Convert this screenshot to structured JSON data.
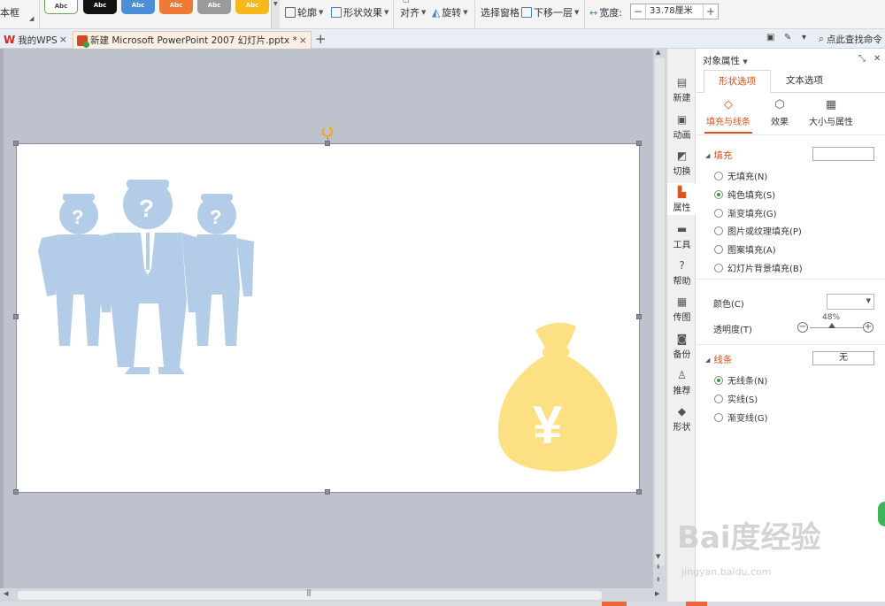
{
  "ribbon": {
    "frame_label": "本框",
    "swatches": [
      "Abc",
      "Abc",
      "Abc",
      "Abc",
      "Abc",
      "Abc"
    ],
    "outline": "轮廓",
    "shape_effects": "形状效果",
    "align": "对齐",
    "rotate": "旋转",
    "selection_pane": "选择窗格",
    "send_backward": "下移一层",
    "width_label": "宽度:",
    "width_value": "33.78厘米",
    "minus": "−",
    "plus": "+"
  },
  "tabs": {
    "home": "我的WPS",
    "doc": "新建 Microsoft PowerPoint 2007 幻灯片.pptx *",
    "search_cmd": "点此查找命令"
  },
  "rail": {
    "items": [
      "新建",
      "动画",
      "切换",
      "属性",
      "工具",
      "帮助",
      "传图",
      "备份",
      "推荐",
      "形状"
    ]
  },
  "panel": {
    "title": "对象属性",
    "tabs": [
      "形状选项",
      "文本选项"
    ],
    "subtabs": [
      "填充与线条",
      "效果",
      "大小与属性"
    ],
    "fill": {
      "heading": "填充",
      "options": [
        "无填充(N)",
        "纯色填充(S)",
        "渐变填充(G)",
        "图片或纹理填充(P)",
        "图案填充(A)",
        "幻灯片背景填充(B)"
      ],
      "selected": 1,
      "color_label": "颜色(C)",
      "transparency_label": "透明度(T)",
      "transparency_value": "48%"
    },
    "line": {
      "heading": "线条",
      "box_value": "无",
      "options": [
        "无线条(N)",
        "实线(S)",
        "渐变线(G)"
      ],
      "selected": 0
    }
  },
  "watermark": {
    "main": "Bai度经验",
    "sub": "jingyan.baidu.com"
  },
  "colors": {
    "accent": "#d9541e",
    "people": "#b3cde9",
    "money_bag": "#fde084",
    "workspace": "#bec2cc"
  }
}
